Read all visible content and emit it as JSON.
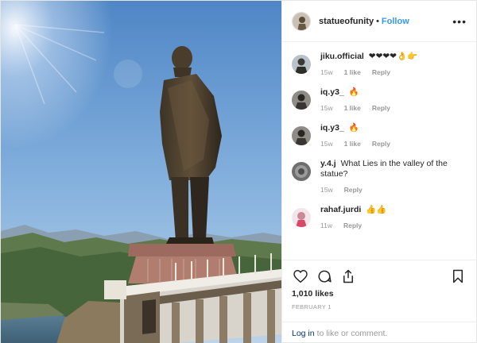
{
  "post": {
    "author": "statueofunity",
    "separator": "•",
    "follow_label": "Follow",
    "more_icon": "more-options-icon"
  },
  "comments": [
    {
      "user": "jiku.official",
      "text": "❤❤❤❤👌👉",
      "time": "15w",
      "likes": "1 like",
      "reply": "Reply"
    },
    {
      "user": "iq.y3_",
      "text": "🔥",
      "time": "15w",
      "likes": "1 like",
      "reply": "Reply"
    },
    {
      "user": "iq.y3_",
      "text": "🔥",
      "time": "15w",
      "likes": "1 like",
      "reply": "Reply"
    },
    {
      "user": "y.4.j",
      "text": "What Lies in the valley of the statue?",
      "time": "15w",
      "likes": "",
      "reply": "Reply"
    },
    {
      "user": "rahaf.jurdi",
      "text": "👍👍",
      "time": "11w",
      "likes": "",
      "reply": "Reply"
    }
  ],
  "actions": {
    "icons": [
      "heart-icon",
      "comment-icon",
      "share-icon",
      "bookmark-icon"
    ],
    "likes": "1,010 likes",
    "date": "FEBRUARY 1"
  },
  "footer": {
    "login_label": "Log in",
    "login_suffix": "to like or comment."
  },
  "colors": {
    "link_blue": "#3897f0",
    "login_blue": "#003569",
    "muted": "#999999",
    "sky": "#6f9fd0"
  }
}
